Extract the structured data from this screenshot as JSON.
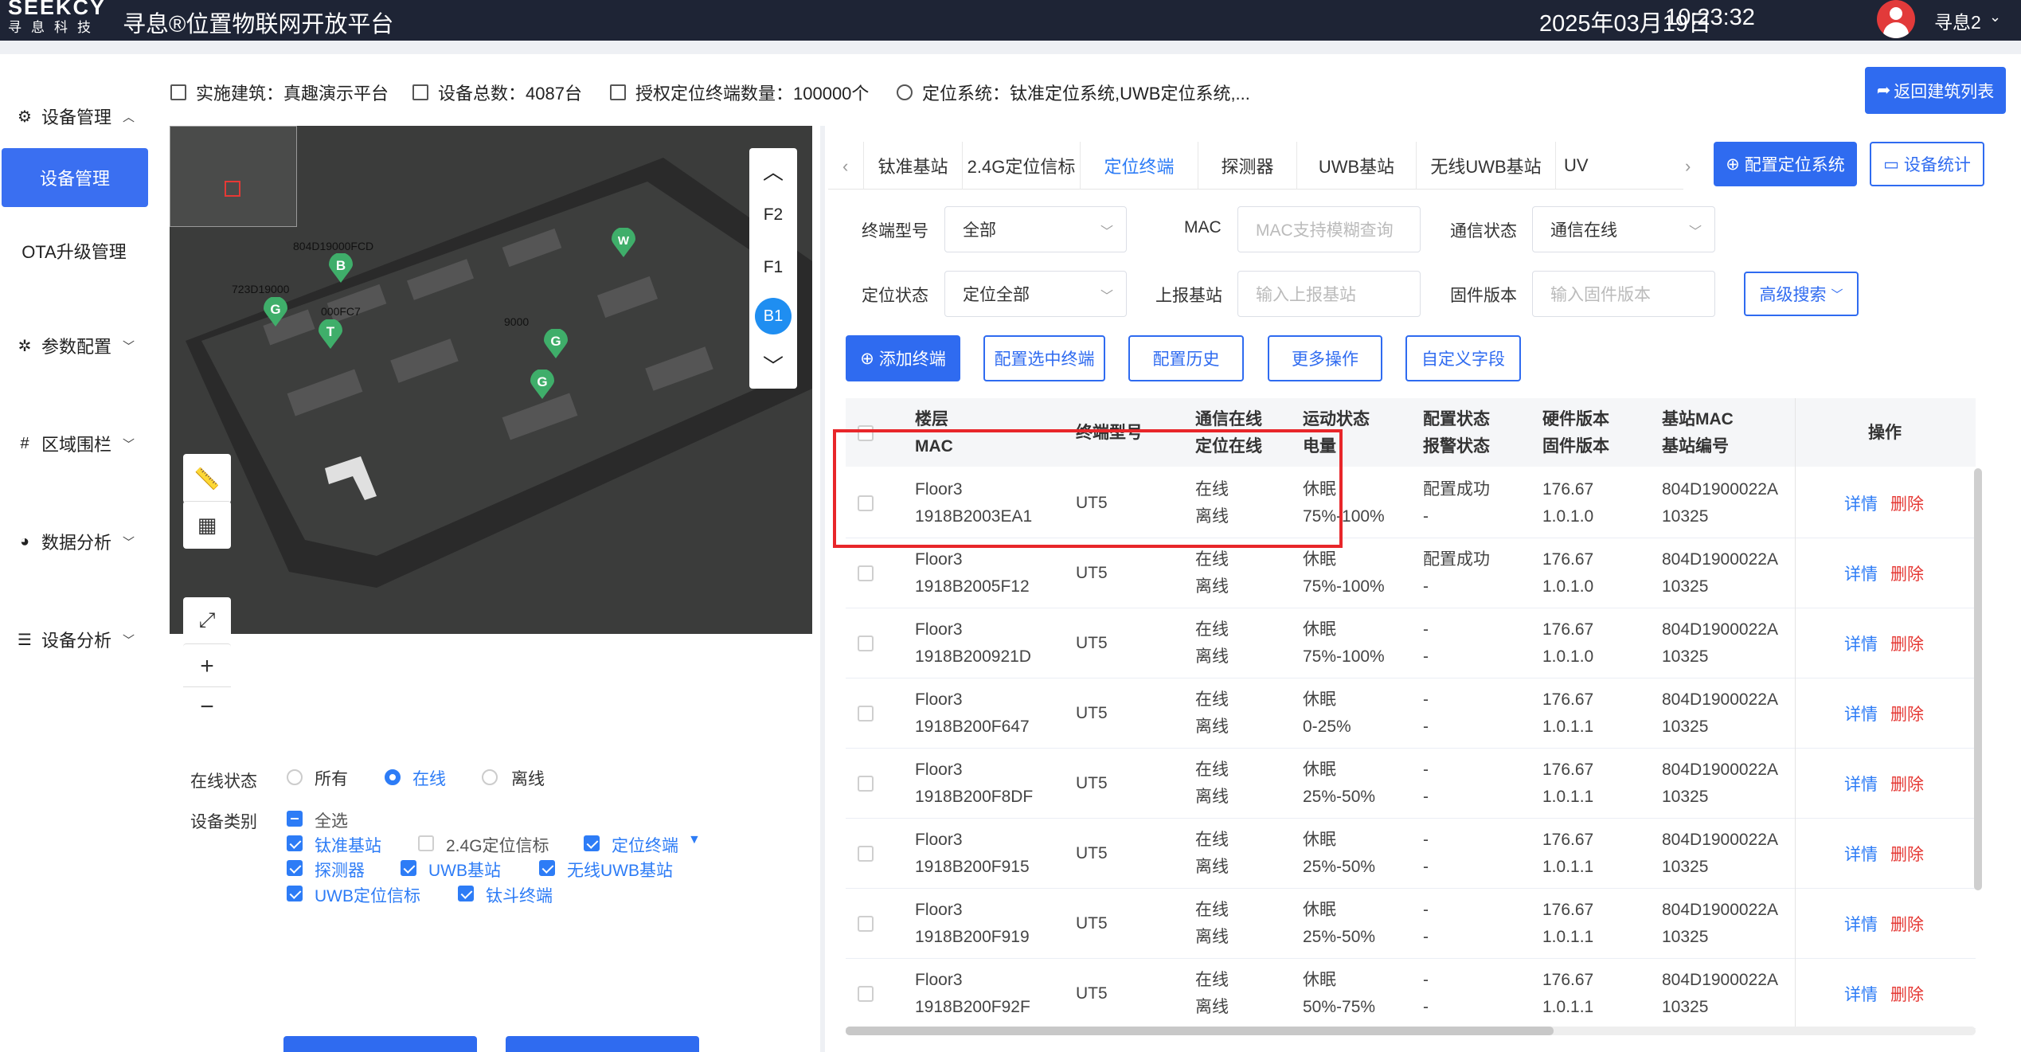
{
  "header": {
    "logo_text": "SEEKCY",
    "logo_sub": "寻息科技",
    "app_title": "寻息®位置物联网开放平台",
    "date": "2025年03月19日",
    "time": "10:23:32",
    "username": "寻息2"
  },
  "sidebar": {
    "items": [
      {
        "label": "设备管理",
        "icon": "gear-icon"
      },
      {
        "label": "设备管理"
      },
      {
        "label": "OTA升级管理"
      },
      {
        "label": "参数配置",
        "icon": "gears-icon"
      },
      {
        "label": "区域围栏",
        "icon": "fence-icon"
      },
      {
        "label": "数据分析",
        "icon": "pie-chart-icon"
      },
      {
        "label": "设备分析",
        "icon": "sliders-icon"
      }
    ]
  },
  "infobar": {
    "building": "实施建筑：真趣演示平台",
    "device_total": "设备总数：4087台",
    "license": "授权定位终端数量：100000个",
    "system": "定位系统：钛准定位系统,UWB定位系统,...",
    "back_label": "返回建筑列表"
  },
  "map": {
    "floors": [
      "F2",
      "F1",
      "B1"
    ],
    "active_floor": "B1",
    "labels": [
      "804D19000FCD",
      "723D19000",
      "000FC7",
      "9000"
    ],
    "markers": [
      "B",
      "G",
      "T",
      "G",
      "G",
      "W"
    ]
  },
  "filters_left": {
    "online_label": "在线状态",
    "online_options": [
      "所有",
      "在线",
      "离线"
    ],
    "online_selected": "在线",
    "category_label": "设备类别",
    "categories": [
      {
        "label": "全选",
        "state": "indeterminate"
      },
      {
        "label": "钛准基站",
        "state": "checked"
      },
      {
        "label": "2.4G定位信标",
        "state": "unchecked"
      },
      {
        "label": "定位终端",
        "state": "checked"
      },
      {
        "label": "探测器",
        "state": "checked"
      },
      {
        "label": "UWB基站",
        "state": "checked"
      },
      {
        "label": "无线UWB基站",
        "state": "checked"
      },
      {
        "label": "UWB定位信标",
        "state": "checked"
      },
      {
        "label": "钛斗终端",
        "state": "checked"
      }
    ]
  },
  "tabs": {
    "items": [
      "钛准基站",
      "2.4G定位信标",
      "定位终端",
      "探测器",
      "UWB基站",
      "无线UWB基站",
      "UV"
    ],
    "active": "定位终端",
    "config_system": "配置定位系统",
    "device_stats": "设备统计"
  },
  "search": {
    "model_label": "终端型号",
    "model_value": "全部",
    "mac_label": "MAC",
    "mac_placeholder": "MAC支持模糊查询",
    "comm_label": "通信状态",
    "comm_value": "通信在线",
    "loc_label": "定位状态",
    "loc_value": "定位全部",
    "report_label": "上报基站",
    "report_placeholder": "输入上报基站",
    "fw_label": "固件版本",
    "fw_placeholder": "输入固件版本",
    "advanced": "高级搜索"
  },
  "actions": {
    "add": "添加终端",
    "config_selected": "配置选中终端",
    "history": "配置历史",
    "more": "更多操作",
    "custom": "自定义字段"
  },
  "table": {
    "headers": {
      "floor": "楼层",
      "mac": "MAC",
      "model": "终端型号",
      "comm": "通信在线",
      "loc": "定位在线",
      "motion": "运动状态",
      "battery": "电量",
      "config": "配置状态",
      "alarm": "报警状态",
      "hw": "硬件版本",
      "fw": "固件版本",
      "bs_mac": "基站MAC",
      "bs_no": "基站编号",
      "ops": "操作"
    },
    "detail_label": "详情",
    "delete_label": "删除",
    "rows": [
      {
        "floor": "Floor3",
        "mac": "1918B2003EA1",
        "model": "UT5",
        "comm": "在线",
        "loc": "离线",
        "motion": "休眠",
        "battery": "75%-100%",
        "config": "配置成功",
        "alarm": "-",
        "hw": "176.67",
        "fw": "1.0.1.0",
        "bs_mac": "804D1900022A",
        "bs_no": "10325"
      },
      {
        "floor": "Floor3",
        "mac": "1918B2005F12",
        "model": "UT5",
        "comm": "在线",
        "loc": "离线",
        "motion": "休眠",
        "battery": "75%-100%",
        "config": "配置成功",
        "alarm": "-",
        "hw": "176.67",
        "fw": "1.0.1.0",
        "bs_mac": "804D1900022A",
        "bs_no": "10325"
      },
      {
        "floor": "Floor3",
        "mac": "1918B200921D",
        "model": "UT5",
        "comm": "在线",
        "loc": "离线",
        "motion": "休眠",
        "battery": "75%-100%",
        "config": "-",
        "alarm": "-",
        "hw": "176.67",
        "fw": "1.0.1.0",
        "bs_mac": "804D1900022A",
        "bs_no": "10325"
      },
      {
        "floor": "Floor3",
        "mac": "1918B200F647",
        "model": "UT5",
        "comm": "在线",
        "loc": "离线",
        "motion": "休眠",
        "battery": "0-25%",
        "config": "-",
        "alarm": "-",
        "hw": "176.67",
        "fw": "1.0.1.1",
        "bs_mac": "804D1900022A",
        "bs_no": "10325"
      },
      {
        "floor": "Floor3",
        "mac": "1918B200F8DF",
        "model": "UT5",
        "comm": "在线",
        "loc": "离线",
        "motion": "休眠",
        "battery": "25%-50%",
        "config": "-",
        "alarm": "-",
        "hw": "176.67",
        "fw": "1.0.1.1",
        "bs_mac": "804D1900022A",
        "bs_no": "10325"
      },
      {
        "floor": "Floor3",
        "mac": "1918B200F915",
        "model": "UT5",
        "comm": "在线",
        "loc": "离线",
        "motion": "休眠",
        "battery": "25%-50%",
        "config": "-",
        "alarm": "-",
        "hw": "176.67",
        "fw": "1.0.1.1",
        "bs_mac": "804D1900022A",
        "bs_no": "10325"
      },
      {
        "floor": "Floor3",
        "mac": "1918B200F919",
        "model": "UT5",
        "comm": "在线",
        "loc": "离线",
        "motion": "休眠",
        "battery": "25%-50%",
        "config": "-",
        "alarm": "-",
        "hw": "176.67",
        "fw": "1.0.1.1",
        "bs_mac": "804D1900022A",
        "bs_no": "10325"
      },
      {
        "floor": "Floor3",
        "mac": "1918B200F92F",
        "model": "UT5",
        "comm": "在线",
        "loc": "离线",
        "motion": "休眠",
        "battery": "50%-75%",
        "config": "-",
        "alarm": "-",
        "hw": "176.67",
        "fw": "1.0.1.1",
        "bs_mac": "804D1900022A",
        "bs_no": "10325"
      }
    ]
  },
  "colors": {
    "primary": "#2f6bf0",
    "danger": "#e53935",
    "header_bg": "#1e2435",
    "highlight": "#e8262a"
  }
}
